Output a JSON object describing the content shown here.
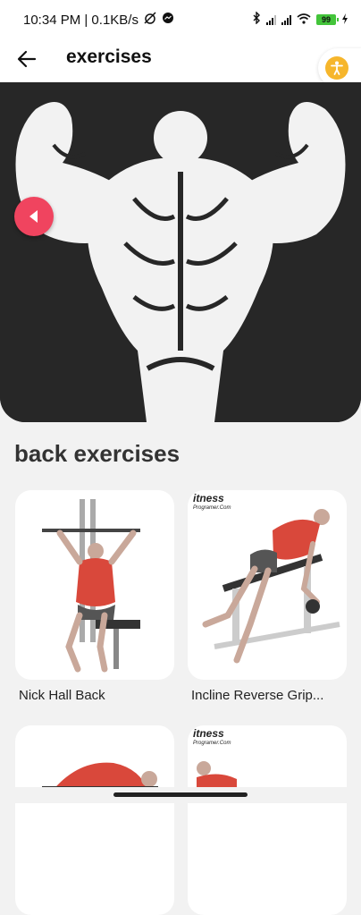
{
  "status_bar": {
    "time_speed": "10:34 PM | 0.1KB/s",
    "battery": "99"
  },
  "app_bar": {
    "title": "exercises"
  },
  "section": {
    "title": "back exercises"
  },
  "exercises": [
    {
      "label": "Nick Hall Back"
    },
    {
      "label": "Incline Reverse Grip..."
    },
    {
      "label": ""
    },
    {
      "label": ""
    }
  ],
  "brand": {
    "name": "itness",
    "sub": "Programer.Com"
  },
  "colors": {
    "accent_pink": "#f0445f",
    "accessibility_orange": "#f6b62c",
    "muscle_red": "#d9483b",
    "hero_bg": "#272727"
  }
}
